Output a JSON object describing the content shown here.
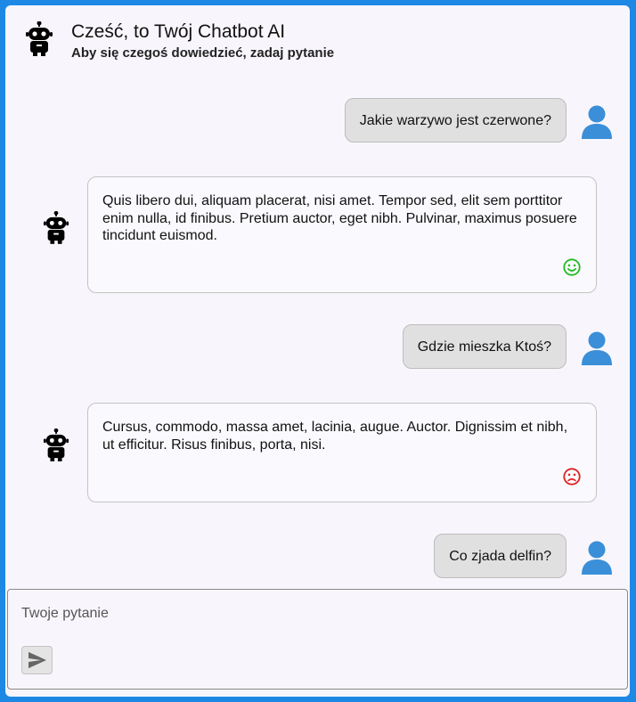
{
  "header": {
    "title": "Cześć, to Twój Chatbot AI",
    "subtitle": "Aby się czegoś dowiedzieć, zadaj pytanie",
    "icon": "robot-icon"
  },
  "messages": [
    {
      "role": "user",
      "text": "Jakie warzywo jest czerwone?",
      "avatar_icon": "user-icon"
    },
    {
      "role": "bot",
      "text": "Quis libero dui, aliquam placerat, nisi amet. Tempor sed, elit sem porttitor enim nulla, id finibus. Pretium auctor, eget nibh. Pulvinar, maximus posuere tincidunt euismod.",
      "avatar_icon": "robot-icon",
      "rating": "positive",
      "rating_icon": "smiley-happy-icon"
    },
    {
      "role": "user",
      "text": "Gdzie mieszka Ktoś?",
      "avatar_icon": "user-icon"
    },
    {
      "role": "bot",
      "text": "Cursus, commodo, massa amet, lacinia, augue. Auctor. Dignissim et nibh, ut efficitur. Risus finibus, porta, nisi.",
      "avatar_icon": "robot-icon",
      "rating": "negative",
      "rating_icon": "smiley-sad-icon"
    },
    {
      "role": "user",
      "text": "Co zjada delfin?",
      "avatar_icon": "user-icon"
    }
  ],
  "input": {
    "value": "",
    "placeholder": "Twoje pytanie",
    "send_icon": "send-icon"
  },
  "colors": {
    "frame": "#1e88e5",
    "background": "#f8f6fc",
    "user_bubble": "#e0e0e0",
    "user_avatar": "#3a8fd8",
    "positive": "#22bb22",
    "negative": "#dd2222"
  }
}
